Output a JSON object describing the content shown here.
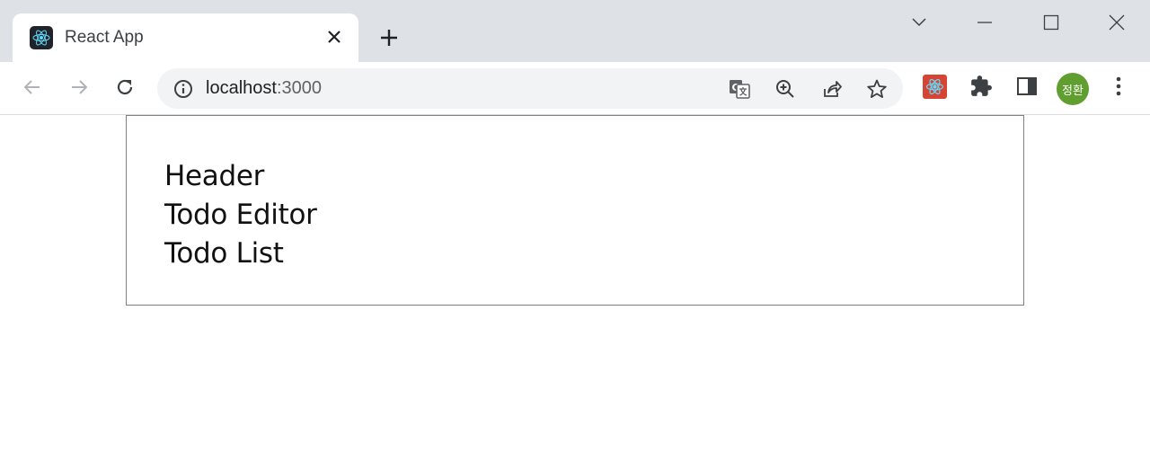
{
  "browser": {
    "tab": {
      "title": "React App",
      "favicon": "react-logo-icon"
    },
    "new_tab_symbol": "+",
    "window_controls": [
      "tab-search-icon",
      "minimize-icon",
      "maximize-icon",
      "close-window-icon"
    ],
    "address_bar": {
      "host": "localhost",
      "port": ":3000"
    },
    "profile": {
      "initials": "정환",
      "color": "#5f9e2f"
    }
  },
  "page": {
    "sections": [
      "Header",
      "Todo Editor",
      "Todo List"
    ]
  },
  "colors": {
    "tabstrip": "#dee1e6",
    "omnibox": "#f1f3f4",
    "box_border": "#808080"
  }
}
